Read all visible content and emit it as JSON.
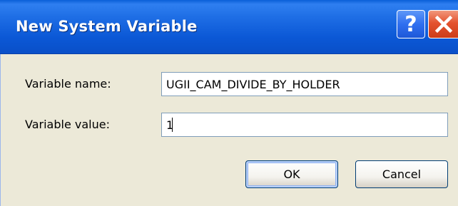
{
  "window": {
    "title": "New System Variable",
    "help_icon": "help-icon",
    "close_icon": "close-icon",
    "help_glyph": "?"
  },
  "form": {
    "name_label": "Variable name:",
    "name_value": "UGII_CAM_DIVIDE_BY_HOLDER",
    "value_label": "Variable value:",
    "value_value": "1"
  },
  "buttons": {
    "ok_label": "OK",
    "cancel_label": "Cancel"
  },
  "colors": {
    "titlebar": "#0b58d6",
    "close_button": "#e4532f",
    "dialog_background": "#ece9d8"
  }
}
